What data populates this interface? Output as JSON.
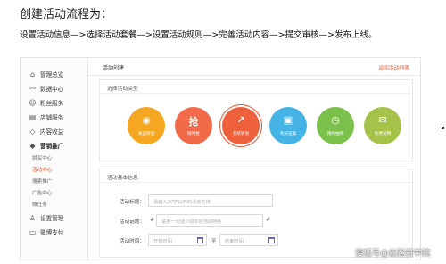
{
  "caption": {
    "title": "创建活动流程为：",
    "steps": "设置活动信息—>选择活动套餐—>设置活动规则—>完善活动内容—>提交审核—>发布上线。"
  },
  "sidebar": {
    "items": [
      {
        "label": "管理总览",
        "icon": "home-icon"
      },
      {
        "label": "数据中心",
        "icon": "trend-icon"
      },
      {
        "label": "粉丝服务",
        "icon": "fans-icon"
      },
      {
        "label": "店铺服务",
        "icon": "store-icon"
      },
      {
        "label": "内容收益",
        "icon": "gem-icon"
      },
      {
        "label": "营销推广",
        "icon": "marketing-icon"
      }
    ],
    "sub_items": [
      "拼买中心",
      "活动中心",
      "搜索推广",
      "广告中心",
      "微任务"
    ],
    "bottom_items": [
      {
        "label": "设置管理",
        "icon": "user-icon"
      },
      {
        "label": "微博支付",
        "icon": "wallet-icon"
      }
    ]
  },
  "main": {
    "page_title": "活动创建",
    "back_link": "返回活动列表",
    "type_panel": {
      "heading": "选择活动类型",
      "types": [
        {
          "label": "幸运转盘",
          "glyph": "◉",
          "color": "#f5a623"
        },
        {
          "label": "限时抢",
          "glyph": "抢",
          "color": "#f36a4a"
        },
        {
          "label": "有奖转发",
          "glyph": "↗",
          "color": "#ee5f3c"
        },
        {
          "label": "有奖征集",
          "glyph": "▣",
          "color": "#46b3e6"
        },
        {
          "label": "预约抽奖",
          "glyph": "◷",
          "color": "#7cc04c"
        },
        {
          "label": "免费试用",
          "glyph": "✉",
          "color": "#a6c24a"
        }
      ],
      "selected_index": 2
    },
    "info_panel": {
      "heading": "活动基本信息",
      "fields": [
        {
          "label": "活动标题：",
          "placeholder": "请输入20字以内的活动名称"
        },
        {
          "label": "活动话题：",
          "placeholder": "请用一句话介绍你的活动特色"
        },
        {
          "label": "活动时间：",
          "start_placeholder": "开始时间",
          "end_placeholder": "结束时间",
          "separator": "至"
        }
      ]
    }
  },
  "watermark": "搜狐号@丝路赞学院",
  "colors": {
    "accent": "#e8522b",
    "calendar": "#7a5fb5"
  }
}
